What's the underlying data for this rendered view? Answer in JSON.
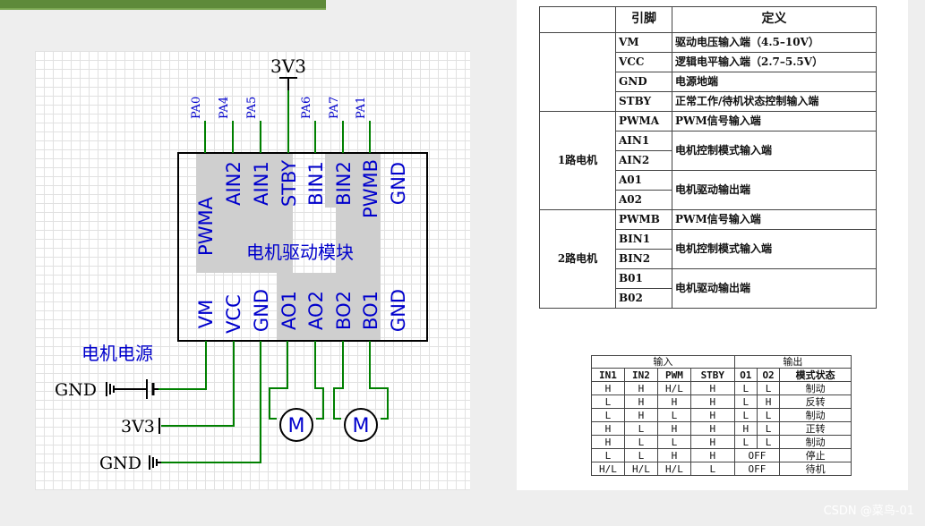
{
  "schematic": {
    "power_top": "3V3",
    "top_pins": [
      "PA0",
      "PA4",
      "PA5",
      "",
      "PA6",
      "PA7",
      "PA1"
    ],
    "chip_top_pins": [
      "PWMA",
      "AIN2",
      "AIN1",
      "STBY",
      "BIN1",
      "BIN2",
      "PWMB",
      "GND"
    ],
    "chip_bottom_pins": [
      "VM",
      "VCC",
      "GND",
      "AO1",
      "AO2",
      "BO2",
      "BO1",
      "GND"
    ],
    "module_name": "电机驱动模块",
    "motor_power_label": "电机电源",
    "left_labels": [
      "GND",
      "3V3",
      "GND"
    ],
    "motor_label": "M"
  },
  "pin_table": {
    "headers": [
      "引脚",
      "定义"
    ],
    "common_rows": [
      {
        "pin": "VM",
        "def": "驱动电压输入端（4.5–10V）"
      },
      {
        "pin": "VCC",
        "def": "逻辑电平输入端（2.7–5.5V）"
      },
      {
        "pin": "GND",
        "def": "电源地端"
      },
      {
        "pin": "STBY",
        "def": "正常工作/待机状态控制输入端"
      }
    ],
    "groups": [
      {
        "name": "1路电机",
        "pwm": "PWMA",
        "pwm_def": "PWM信号输入端",
        "in1": "AIN1",
        "in2": "AIN2",
        "in_def": "电机控制模式输入端",
        "out1": "A01",
        "out2": "A02",
        "out_def": "电机驱动输出端"
      },
      {
        "name": "2路电机",
        "pwm": "PWMB",
        "pwm_def": "PWM信号输入端",
        "in1": "BIN1",
        "in2": "BIN2",
        "in_def": "电机控制模式输入端",
        "out1": "B01",
        "out2": "B02",
        "out_def": "电机驱动输出端"
      }
    ]
  },
  "truth_table": {
    "group_in": "输入",
    "group_out": "输出",
    "headers": [
      "IN1",
      "IN2",
      "PWM",
      "STBY",
      "O1",
      "O2",
      "模式状态"
    ],
    "rows": [
      [
        "H",
        "H",
        "H/L",
        "H",
        "L",
        "L",
        "制动"
      ],
      [
        "L",
        "H",
        "H",
        "H",
        "L",
        "H",
        "反转"
      ],
      [
        "L",
        "H",
        "L",
        "H",
        "L",
        "L",
        "制动"
      ],
      [
        "H",
        "L",
        "H",
        "H",
        "H",
        "L",
        "正转"
      ],
      [
        "H",
        "L",
        "L",
        "H",
        "L",
        "L",
        "制动"
      ],
      [
        "L",
        "L",
        "H",
        "H",
        "OFF",
        "",
        "停止"
      ],
      [
        "H/L",
        "H/L",
        "H/L",
        "L",
        "OFF",
        "",
        "待机"
      ]
    ]
  },
  "watermark": "CSDN @菜鸟-01",
  "colors": {
    "wire": "#008000",
    "pin_text": "#0000cc",
    "chip_gray": "#cfcfcf",
    "topbar": "#5e8a3a"
  }
}
